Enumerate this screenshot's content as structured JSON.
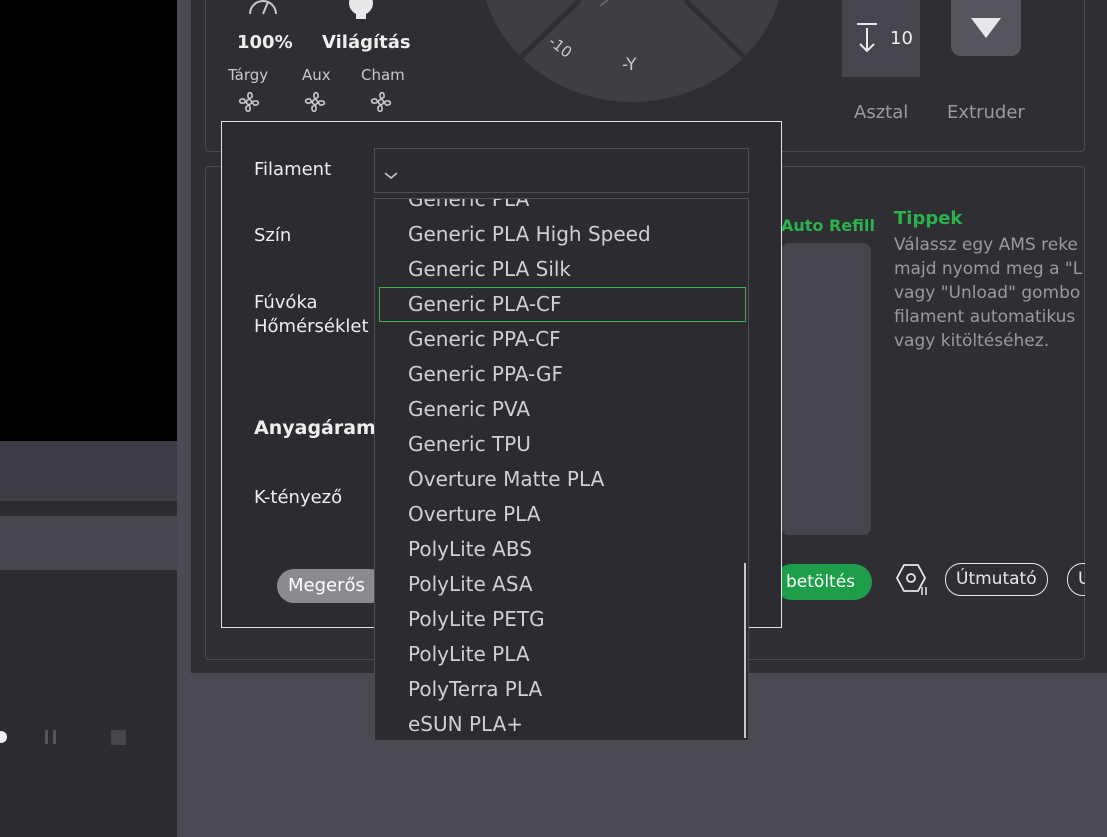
{
  "status": {
    "speed_value": "100%",
    "lighting_label": "Világítás",
    "fans": [
      {
        "label": "Tárgy",
        "icon": "fan-icon"
      },
      {
        "label": "Aux",
        "icon": "fan-icon"
      },
      {
        "label": "Cham",
        "icon": "fan-icon"
      }
    ]
  },
  "jog": {
    "minus_ten": "-10",
    "minus_y": "-Y"
  },
  "bed_extruder": {
    "z_step": "10",
    "bed_label": "Asztal",
    "extruder_label": "Extruder"
  },
  "ams": {
    "auto_refill": "Auto Refill",
    "tips_title": "Tippek",
    "tips_text": "Válassz egy AMS reke\nmajd nyomd meg a \"L\nvagy \"Unload\" gombo\nfilament automatikus\nvagy kitöltéséhez.",
    "load_button": "betöltés",
    "guide_button": "Útmutató",
    "extra_button": "U",
    "paren": ")"
  },
  "dialog": {
    "filament_label": "Filament",
    "filament_value": "",
    "color_label": "Szín",
    "nozzle_label_1": "Fúvóka",
    "nozzle_label_2": "Hőmérséklet",
    "flow_label": "Anyagáraml",
    "k_label": "K-tényező",
    "confirm_button": "Megerős"
  },
  "dropdown": {
    "partial_top": "Generic PLA",
    "options": [
      "Generic PLA High Speed",
      "Generic PLA Silk",
      "Generic PLA-CF",
      "Generic PPA-CF",
      "Generic PPA-GF",
      "Generic PVA",
      "Generic TPU",
      "Overture Matte PLA",
      "Overture PLA",
      "PolyLite ABS",
      "PolyLite ASA",
      "PolyLite PETG",
      "PolyLite PLA",
      "PolyTerra PLA",
      "eSUN PLA+"
    ],
    "selected_index": 2
  },
  "colors": {
    "accent_green": "#1f9e4a",
    "selection_outline": "#3fae5a",
    "tips_green": "#2bb24c"
  }
}
